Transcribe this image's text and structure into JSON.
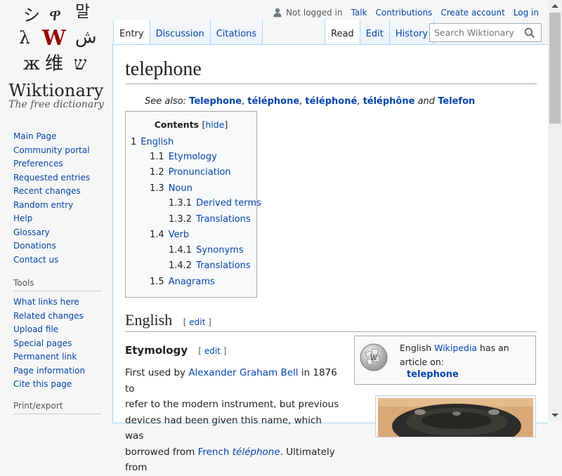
{
  "logo": {
    "glyphs": [
      "シ",
      "ዋ",
      "말",
      "λ",
      "W",
      "ش",
      "ж",
      "维",
      "ש"
    ],
    "wordmark": "Wiktionary",
    "tagline": "The free dictionary"
  },
  "nav": {
    "main": [
      "Main Page",
      "Community portal",
      "Preferences",
      "Requested entries",
      "Recent changes",
      "Random entry",
      "Help",
      "Glossary",
      "Donations",
      "Contact us"
    ],
    "tools_heading": "Tools",
    "tools": [
      "What links here",
      "Related changes",
      "Upload file",
      "Special pages",
      "Permanent link",
      "Page information",
      "Cite this page"
    ],
    "print_heading": "Print/export"
  },
  "personal": {
    "not_logged_in": "Not logged in",
    "talk": "Talk",
    "contributions": "Contributions",
    "create_account": "Create account",
    "log_in": "Log in"
  },
  "tabs": {
    "left": [
      "Entry",
      "Discussion",
      "Citations"
    ],
    "right": [
      "Read",
      "Edit",
      "History"
    ]
  },
  "search": {
    "placeholder": "Search Wiktionary"
  },
  "page": {
    "title": "telephone",
    "see_also": {
      "label": "See also:",
      "items": [
        "Telephone",
        "téléphone",
        "téléphoné",
        "téléphône",
        "Telefon"
      ],
      "and": "and"
    }
  },
  "toc": {
    "title": "Contents",
    "hide": "hide",
    "entries": [
      {
        "num": "1",
        "label": "English"
      },
      {
        "num": "1.1",
        "label": "Etymology"
      },
      {
        "num": "1.2",
        "label": "Pronunciation"
      },
      {
        "num": "1.3",
        "label": "Noun"
      },
      {
        "num": "1.3.1",
        "label": "Derived terms"
      },
      {
        "num": "1.3.2",
        "label": "Translations"
      },
      {
        "num": "1.4",
        "label": "Verb"
      },
      {
        "num": "1.4.1",
        "label": "Synonyms"
      },
      {
        "num": "1.4.2",
        "label": "Translations"
      },
      {
        "num": "1.5",
        "label": "Anagrams"
      }
    ]
  },
  "sections": {
    "english": "English",
    "etymology": "Etymology",
    "edit": "edit",
    "etymology_lines": {
      "l1_a": "First used by ",
      "l1_link": "Alexander Graham Bell",
      "l1_b": " in 1876 to",
      "l2": "refer to the modern instrument, but previous",
      "l3": "devices had been given this name, which was",
      "l4_a": "borrowed from ",
      "l4_link1": "French",
      "l4_link2": "téléphone",
      "l4_b": ". Ultimately from"
    }
  },
  "wikipedia_box": {
    "prefix": "English ",
    "link": "Wikipedia",
    "suffix": " has an article on:",
    "article": "telephone"
  }
}
